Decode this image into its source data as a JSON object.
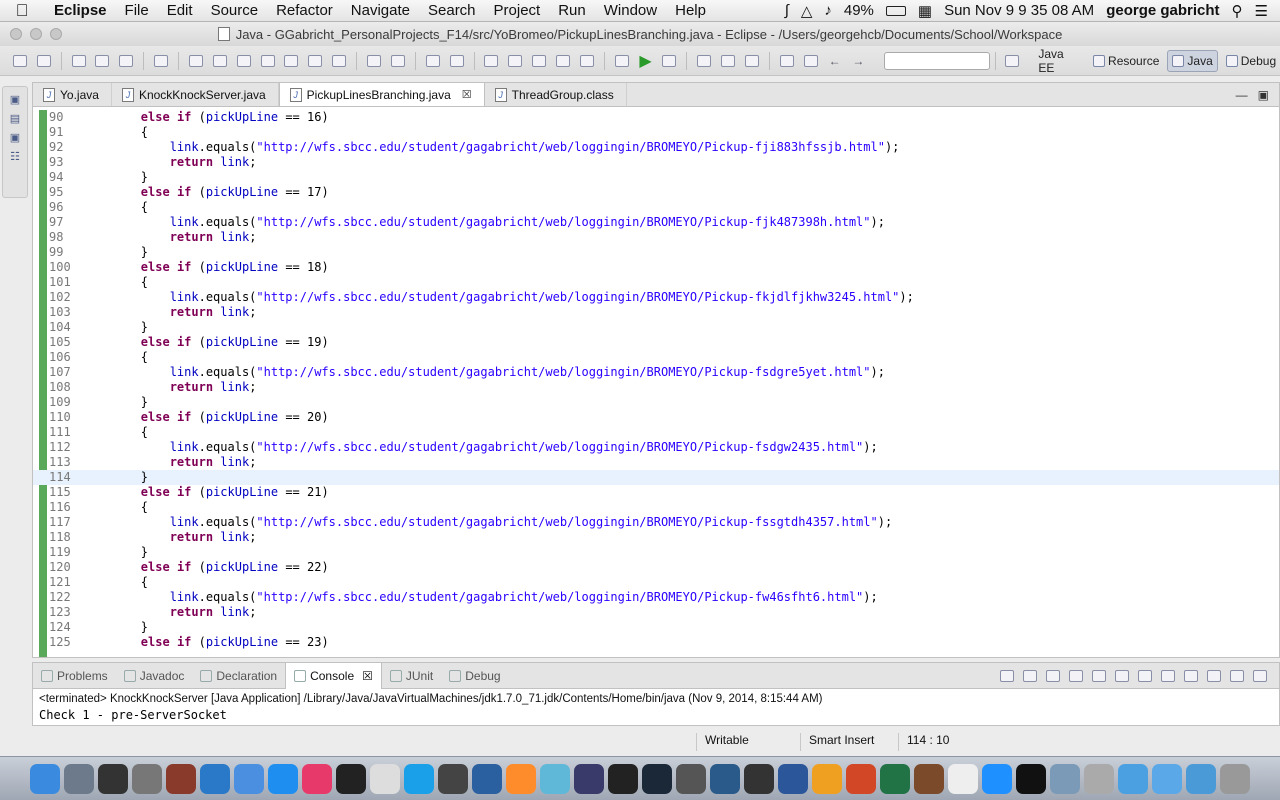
{
  "menubar": {
    "app": "Eclipse",
    "items": [
      "File",
      "Edit",
      "Source",
      "Refactor",
      "Navigate",
      "Search",
      "Project",
      "Run",
      "Window",
      "Help"
    ],
    "battery": "49%",
    "clock": "Sun Nov 9  9 35 08 AM",
    "user": "george gabricht"
  },
  "window": {
    "title": "Java - GGabricht_PersonalProjects_F14/src/YoBromeo/PickupLinesBranching.java - Eclipse - /Users/georgehcb/Documents/School/Workspace"
  },
  "toolbar": {
    "perspectives": [
      {
        "label": "Java EE",
        "active": false
      },
      {
        "label": "Resource",
        "active": false
      },
      {
        "label": "Java",
        "active": true
      },
      {
        "label": "Debug",
        "active": false
      }
    ]
  },
  "editor": {
    "tabs": [
      {
        "label": "Yo.java",
        "active": false
      },
      {
        "label": "KnockKnockServer.java",
        "active": false
      },
      {
        "label": "PickupLinesBranching.java",
        "active": true
      },
      {
        "label": "ThreadGroup.class",
        "active": false
      }
    ],
    "current_line": 114,
    "lines": [
      {
        "n": "90",
        "t": "        else if (pickUpLine == 16)"
      },
      {
        "n": "91",
        "t": "        {"
      },
      {
        "n": "92",
        "t": "            link.equals(\"http://wfs.sbcc.edu/student/gagabricht/web/loggingin/BROMEYO/Pickup-fji883hfssjb.html\");"
      },
      {
        "n": "93",
        "t": "            return link;"
      },
      {
        "n": "94",
        "t": "        }"
      },
      {
        "n": "95",
        "t": "        else if (pickUpLine == 17)"
      },
      {
        "n": "96",
        "t": "        {"
      },
      {
        "n": "97",
        "t": "            link.equals(\"http://wfs.sbcc.edu/student/gagabricht/web/loggingin/BROMEYO/Pickup-fjk487398h.html\");"
      },
      {
        "n": "98",
        "t": "            return link;"
      },
      {
        "n": "99",
        "t": "        }"
      },
      {
        "n": "100",
        "t": "        else if (pickUpLine == 18)"
      },
      {
        "n": "101",
        "t": "        {"
      },
      {
        "n": "102",
        "t": "            link.equals(\"http://wfs.sbcc.edu/student/gagabricht/web/loggingin/BROMEYO/Pickup-fkjdlfjkhw3245.html\");"
      },
      {
        "n": "103",
        "t": "            return link;"
      },
      {
        "n": "104",
        "t": "        }"
      },
      {
        "n": "105",
        "t": "        else if (pickUpLine == 19)"
      },
      {
        "n": "106",
        "t": "        {"
      },
      {
        "n": "107",
        "t": "            link.equals(\"http://wfs.sbcc.edu/student/gagabricht/web/loggingin/BROMEYO/Pickup-fsdgre5yet.html\");"
      },
      {
        "n": "108",
        "t": "            return link;"
      },
      {
        "n": "109",
        "t": "        }"
      },
      {
        "n": "110",
        "t": "        else if (pickUpLine == 20)"
      },
      {
        "n": "111",
        "t": "        {"
      },
      {
        "n": "112",
        "t": "            link.equals(\"http://wfs.sbcc.edu/student/gagabricht/web/loggingin/BROMEYO/Pickup-fsdgw2435.html\");"
      },
      {
        "n": "113",
        "t": "            return link;"
      },
      {
        "n": "114",
        "t": "        }"
      },
      {
        "n": "115",
        "t": "        else if (pickUpLine == 21)"
      },
      {
        "n": "116",
        "t": "        {"
      },
      {
        "n": "117",
        "t": "            link.equals(\"http://wfs.sbcc.edu/student/gagabricht/web/loggingin/BROMEYO/Pickup-fssgtdh4357.html\");"
      },
      {
        "n": "118",
        "t": "            return link;"
      },
      {
        "n": "119",
        "t": "        }"
      },
      {
        "n": "120",
        "t": "        else if (pickUpLine == 22)"
      },
      {
        "n": "121",
        "t": "        {"
      },
      {
        "n": "122",
        "t": "            link.equals(\"http://wfs.sbcc.edu/student/gagabricht/web/loggingin/BROMEYO/Pickup-fw46sfht6.html\");"
      },
      {
        "n": "123",
        "t": "            return link;"
      },
      {
        "n": "124",
        "t": "        }"
      },
      {
        "n": "125",
        "t": "        else if (pickUpLine == 23)"
      }
    ]
  },
  "bottom_panel": {
    "tabs": [
      {
        "label": "Problems",
        "active": false
      },
      {
        "label": "Javadoc",
        "active": false
      },
      {
        "label": "Declaration",
        "active": false
      },
      {
        "label": "Console",
        "active": true
      },
      {
        "label": "JUnit",
        "active": false
      },
      {
        "label": "Debug",
        "active": false
      }
    ],
    "terminated": "<terminated> KnockKnockServer [Java Application] /Library/Java/JavaVirtualMachines/jdk1.7.0_71.jdk/Contents/Home/bin/java (Nov 9, 2014, 8:15:44 AM)",
    "output": "Check 1 - pre-ServerSocket"
  },
  "statusbar": {
    "writable": "Writable",
    "insert_mode": "Smart Insert",
    "position": "114 : 10"
  },
  "dock": {
    "apps": [
      "finder-icon",
      "launchpad-icon",
      "activity-monitor-icon",
      "system-preferences-icon",
      "photo-booth-icon",
      "xcode-icon",
      "bluetooth-app-icon",
      "app-store-icon",
      "itunes-icon",
      "terminal-like-icon",
      "chrome-icon",
      "skype-icon",
      "calculator-icon",
      "quicktime-icon",
      "sublime-icon",
      "atom-icon",
      "eclipse-icon",
      "unreal-icon",
      "steam-icon",
      "drive-icon",
      "blender-icon",
      "unity-icon",
      "word-icon",
      "outlook-icon",
      "powerpoint-icon",
      "excel-icon",
      "notes-icon",
      "textedit-icon",
      "safari-icon",
      "terminal-icon",
      "preview-icon",
      "textwrangler-icon",
      "applications-folder-icon",
      "documents-folder-icon",
      "downloads-folder-icon",
      "trash-icon"
    ]
  }
}
